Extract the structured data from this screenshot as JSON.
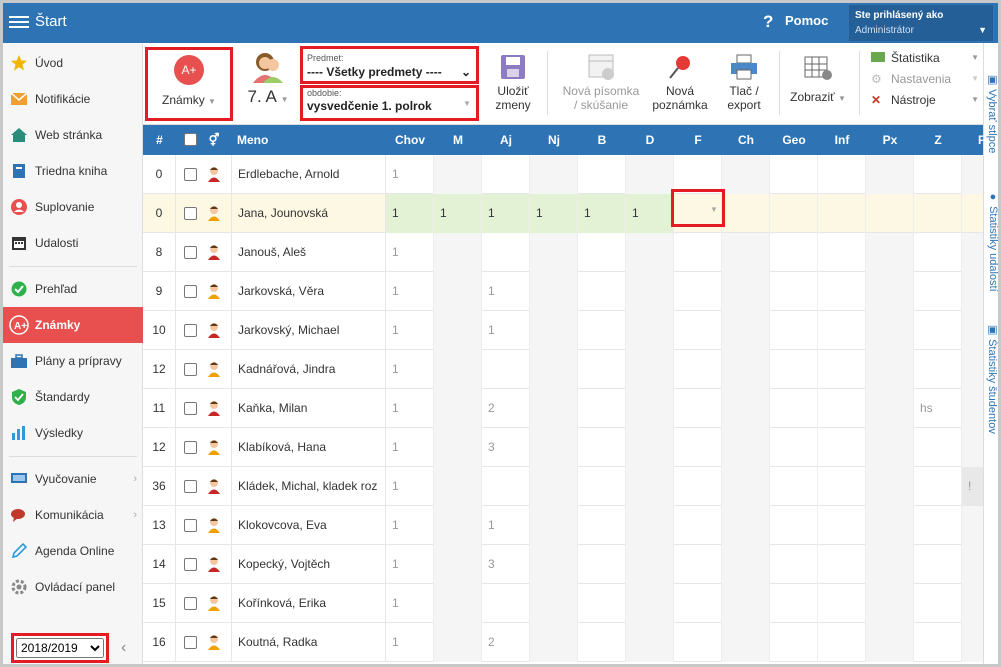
{
  "header": {
    "title": "Štart",
    "help": "Pomoc",
    "user_line1": "Ste prihlásený ako",
    "user_line2": "Administrátor"
  },
  "sidebar": {
    "items": [
      {
        "label": "Úvod",
        "icon": "star-icon"
      },
      {
        "label": "Notifikácie",
        "icon": "envelope-icon"
      },
      {
        "label": "Web stránka",
        "icon": "home-icon"
      },
      {
        "label": "Triedna kniha",
        "icon": "book-icon"
      },
      {
        "label": "Suplovanie",
        "icon": "person-icon"
      },
      {
        "label": "Udalosti",
        "icon": "calendar-icon"
      },
      {
        "label": "Prehľad",
        "icon": "check-icon"
      },
      {
        "label": "Známky",
        "icon": "grade-icon"
      },
      {
        "label": "Plány a prípravy",
        "icon": "briefcase-icon"
      },
      {
        "label": "Štandardy",
        "icon": "shield-icon"
      },
      {
        "label": "Výsledky",
        "icon": "bar-chart-icon"
      },
      {
        "label": "Vyučovanie",
        "icon": "board-icon"
      },
      {
        "label": "Komunikácia",
        "icon": "chat-icon"
      },
      {
        "label": "Agenda Online",
        "icon": "pen-icon"
      },
      {
        "label": "Ovládací panel",
        "icon": "gear-icon"
      }
    ],
    "year": "2018/2019"
  },
  "toolbar": {
    "znamky": "Známky",
    "trieda": "7. A",
    "predmet_label": "Predmet:",
    "predmet_value": "---- Všetky predmety ----",
    "obdobie_label": "obdobie:",
    "obdobie_value": "vysvedčenie 1. polrok",
    "ulozit1": "Uložiť",
    "ulozit2": "zmeny",
    "pisomka1": "Nová písomka",
    "pisomka2": "/ skúšanie",
    "poznamka1": "Nová",
    "poznamka2": "poznámka",
    "tlac1": "Tlač /",
    "tlac2": "export",
    "zobrazit": "Zobraziť",
    "statistika": "Štatistika",
    "nastavenia": "Nastavenia",
    "nastroje": "Nástroje"
  },
  "rail": {
    "vybrat": "Vybrať stĺpce",
    "udalosti": "Štatistiky udalostí",
    "studentov": "Štatistiky študentov"
  },
  "grid": {
    "columns": [
      "#",
      "Meno",
      "Chov",
      "M",
      "Aj",
      "Nj",
      "B",
      "D",
      "F",
      "Ch",
      "Geo",
      "Inf",
      "Px",
      "Z",
      "F..."
    ],
    "rows": [
      {
        "num": "0",
        "name": "Erdlebache, Arnold",
        "g": [
          "1",
          "",
          "",
          "",
          "",
          "",
          "",
          "",
          "",
          "",
          "",
          "",
          ""
        ],
        "sex": "m"
      },
      {
        "num": "0",
        "name": "Jana, Jounovská",
        "g": [
          "1",
          "1",
          "1",
          "1",
          "1",
          "1",
          "",
          "",
          "",
          "",
          "",
          "",
          ""
        ],
        "sex": "f",
        "sel": true
      },
      {
        "num": "8",
        "name": "Janouš, Aleš",
        "g": [
          "1",
          "",
          "",
          "",
          "",
          "",
          "",
          "",
          "",
          "",
          "",
          "",
          ""
        ],
        "sex": "m"
      },
      {
        "num": "9",
        "name": "Jarkovská, Věra",
        "g": [
          "1",
          "",
          "1",
          "",
          "",
          "",
          "",
          "",
          "",
          "",
          "",
          "",
          ""
        ],
        "sex": "f"
      },
      {
        "num": "10",
        "name": "Jarkovský, Michael",
        "g": [
          "1",
          "",
          "1",
          "",
          "",
          "",
          "",
          "",
          "",
          "",
          "",
          "",
          ""
        ],
        "sex": "m"
      },
      {
        "num": "12",
        "name": "Kadnářová, Jindra",
        "g": [
          "1",
          "",
          "",
          "",
          "",
          "",
          "",
          "",
          "",
          "",
          "",
          "",
          ""
        ],
        "sex": "f"
      },
      {
        "num": "11",
        "name": "Kaňka, Milan",
        "g": [
          "1",
          "",
          "2",
          "",
          "",
          "",
          "",
          "",
          "",
          "",
          "",
          "hs",
          ""
        ],
        "sex": "m"
      },
      {
        "num": "12",
        "name": "Klabíková, Hana",
        "g": [
          "1",
          "",
          "3",
          "",
          "",
          "",
          "",
          "",
          "",
          "",
          "",
          "",
          ""
        ],
        "sex": "f"
      },
      {
        "num": "36",
        "name": "Kládek, Michal, kladek roz",
        "g": [
          "1",
          "",
          "",
          "",
          "",
          "",
          "",
          "",
          "",
          "",
          "",
          "",
          "!"
        ],
        "sex": "m"
      },
      {
        "num": "13",
        "name": "Klokovcova, Eva",
        "g": [
          "1",
          "",
          "1",
          "",
          "",
          "",
          "",
          "",
          "",
          "",
          "",
          "",
          ""
        ],
        "sex": "f"
      },
      {
        "num": "14",
        "name": "Kopecký, Vojtěch",
        "g": [
          "1",
          "",
          "3",
          "",
          "",
          "",
          "",
          "",
          "",
          "",
          "",
          "",
          ""
        ],
        "sex": "m"
      },
      {
        "num": "15",
        "name": "Kořínková, Erika",
        "g": [
          "1",
          "",
          "",
          "",
          "",
          "",
          "",
          "",
          "",
          "",
          "",
          "",
          ""
        ],
        "sex": "f"
      },
      {
        "num": "16",
        "name": "Koutná, Radka",
        "g": [
          "1",
          "",
          "2",
          "",
          "",
          "",
          "",
          "",
          "",
          "",
          "",
          "",
          ""
        ],
        "sex": "f"
      }
    ]
  },
  "colors": {
    "primary": "#2e74b5",
    "accent": "#e8504f",
    "highlight": "#e31b23"
  }
}
